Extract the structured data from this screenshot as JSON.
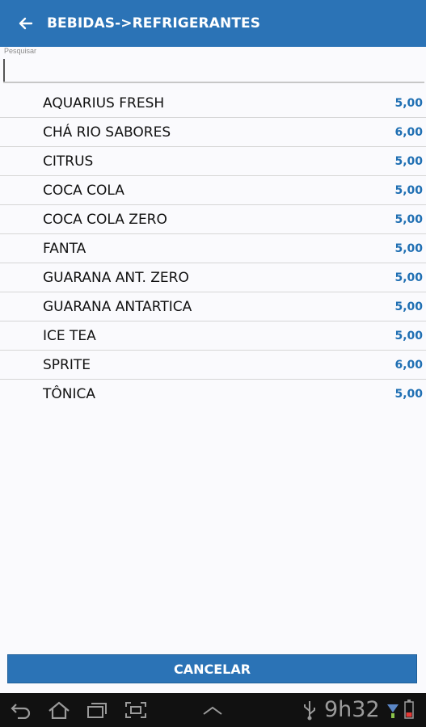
{
  "header": {
    "title": "BEBIDAS->REFRIGERANTES",
    "back_icon": "arrow-left-icon"
  },
  "search": {
    "label": "Pesquisar",
    "value": "",
    "placeholder": ""
  },
  "items": [
    {
      "name": "AQUARIUS FRESH",
      "price": "5,00"
    },
    {
      "name": "CHÁ RIO SABORES",
      "price": "6,00"
    },
    {
      "name": "CITRUS",
      "price": "5,00"
    },
    {
      "name": "COCA COLA",
      "price": "5,00"
    },
    {
      "name": "COCA COLA ZERO",
      "price": "5,00"
    },
    {
      "name": "FANTA",
      "price": "5,00"
    },
    {
      "name": "GUARANA ANT. ZERO",
      "price": "5,00"
    },
    {
      "name": "GUARANA ANTARTICA",
      "price": "5,00"
    },
    {
      "name": "ICE TEA",
      "price": "5,00"
    },
    {
      "name": "SPRITE",
      "price": "6,00"
    },
    {
      "name": "TÔNICA",
      "price": "5,00"
    }
  ],
  "footer": {
    "cancel_label": "CANCELAR"
  },
  "system_bar": {
    "time": "9h32",
    "icons": [
      "back-icon",
      "home-icon",
      "recent-apps-icon",
      "screenshot-icon",
      "chevron-up-icon",
      "usb-icon",
      "signal-icon",
      "battery-icon"
    ]
  },
  "colors": {
    "primary": "#2b73b6",
    "price": "#1f6fb3",
    "background": "#fafafd",
    "system_bar": "#111111"
  }
}
